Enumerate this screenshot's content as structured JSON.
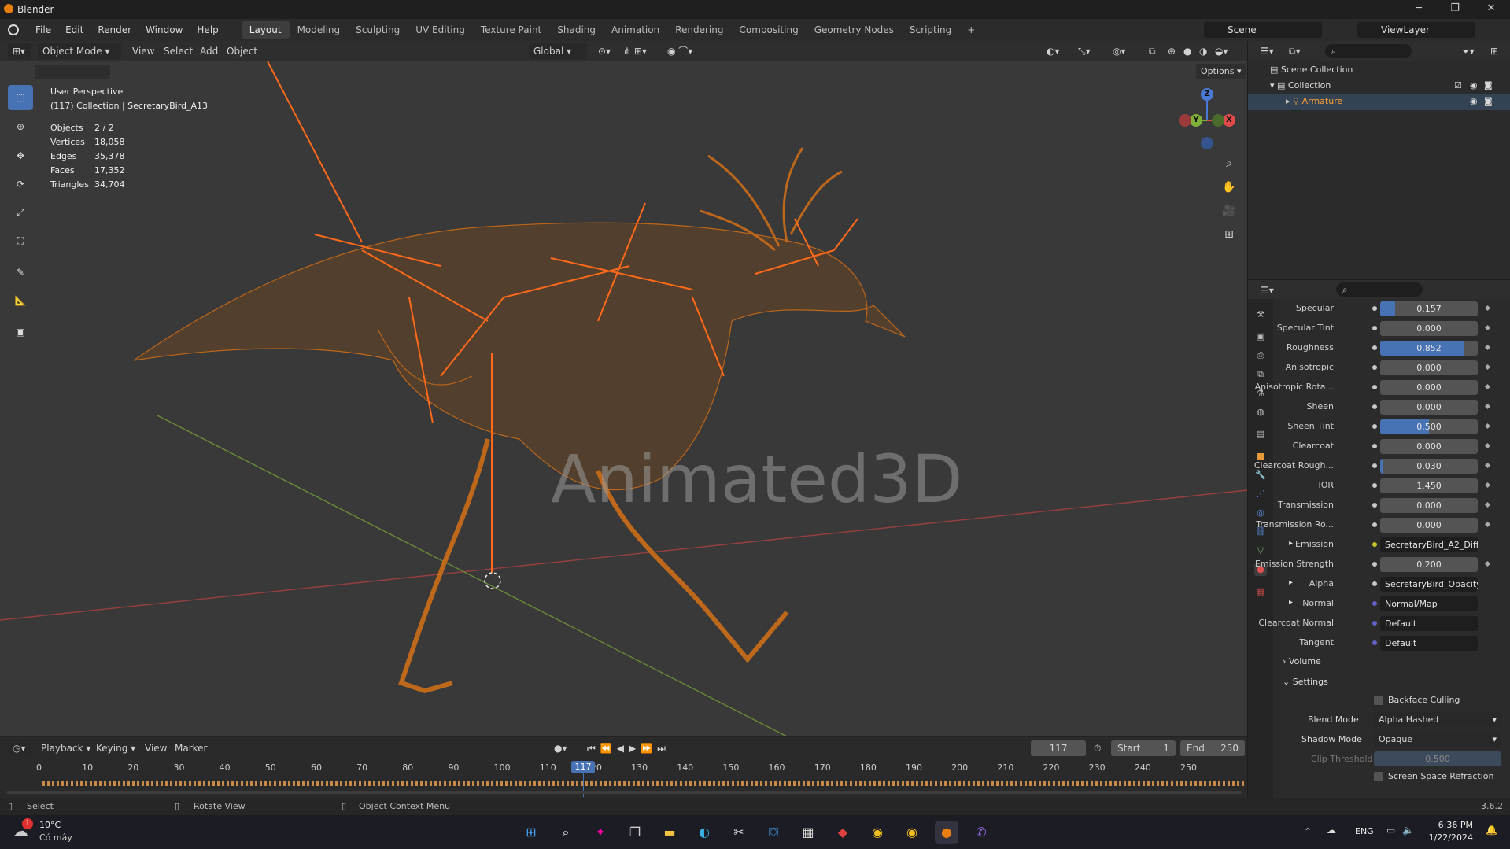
{
  "app": {
    "title": "Blender",
    "version": "3.6.2"
  },
  "window_controls": {
    "minimize": "─",
    "maximize": "❐",
    "close": "✕"
  },
  "menus": [
    "File",
    "Edit",
    "Render",
    "Window",
    "Help"
  ],
  "workspaces": [
    "Layout",
    "Modeling",
    "Sculpting",
    "UV Editing",
    "Texture Paint",
    "Shading",
    "Animation",
    "Rendering",
    "Compositing",
    "Geometry Nodes",
    "Scripting"
  ],
  "workspace_add": "+",
  "scene": {
    "name": "Scene",
    "view_layer": "ViewLayer"
  },
  "viewport_header": {
    "mode": "Object Mode",
    "menus": [
      "View",
      "Select",
      "Add",
      "Object"
    ],
    "orientation": "Global",
    "options": "Options"
  },
  "overlay": {
    "perspective": "User Perspective",
    "collection": "(117) Collection | SecretaryBird_A13",
    "stats": [
      {
        "label": "Objects",
        "value": "2 / 2"
      },
      {
        "label": "Vertices",
        "value": "18,058"
      },
      {
        "label": "Edges",
        "value": "35,378"
      },
      {
        "label": "Faces",
        "value": "17,352"
      },
      {
        "label": "Triangles",
        "value": "34,704"
      }
    ],
    "watermark": "Animated3D"
  },
  "gizmo": {
    "z": "Z",
    "y": "Y",
    "x": "X"
  },
  "outliner": {
    "root": "Scene Collection",
    "collection": "Collection",
    "object": "Armature"
  },
  "properties": {
    "rows": [
      {
        "label": "Specular",
        "value": "0.157",
        "fill": 0.157,
        "type": "slider"
      },
      {
        "label": "Specular Tint",
        "value": "0.000",
        "fill": 0,
        "type": "slider"
      },
      {
        "label": "Roughness",
        "value": "0.852",
        "fill": 0.852,
        "type": "slider"
      },
      {
        "label": "Anisotropic",
        "value": "0.000",
        "fill": 0,
        "type": "slider"
      },
      {
        "label": "Anisotropic Rota...",
        "value": "0.000",
        "fill": 0,
        "type": "slider"
      },
      {
        "label": "Sheen",
        "value": "0.000",
        "fill": 0,
        "type": "slider"
      },
      {
        "label": "Sheen Tint",
        "value": "0.500",
        "fill": 0.5,
        "type": "slider"
      },
      {
        "label": "Clearcoat",
        "value": "0.000",
        "fill": 0,
        "type": "slider"
      },
      {
        "label": "Clearcoat Rough...",
        "value": "0.030",
        "fill": 0.03,
        "type": "slider"
      },
      {
        "label": "IOR",
        "value": "1.450",
        "fill": 0,
        "type": "slider"
      },
      {
        "label": "Transmission",
        "value": "0.000",
        "fill": 0,
        "type": "slider"
      },
      {
        "label": "Transmission Ro...",
        "value": "0.000",
        "fill": 0,
        "type": "slider"
      },
      {
        "label": "Emission",
        "value": "SecretaryBird_A2_Diff...",
        "type": "link",
        "dot": "yel",
        "expand": true
      },
      {
        "label": "Emission Strength",
        "value": "0.200",
        "fill": 0,
        "type": "slider"
      },
      {
        "label": "Alpha",
        "value": "SecretaryBird_Opacity...",
        "type": "link",
        "dot": "gray",
        "expand": true
      },
      {
        "label": "Normal",
        "value": "Normal/Map",
        "type": "link",
        "dot": "blu",
        "expand": true
      },
      {
        "label": "Clearcoat Normal",
        "value": "Default",
        "type": "link",
        "dot": "blu"
      },
      {
        "label": "Tangent",
        "value": "Default",
        "type": "link",
        "dot": "blu"
      }
    ],
    "volume": "Volume",
    "settings": "Settings",
    "backface": "Backface Culling",
    "blend_mode_label": "Blend Mode",
    "blend_mode": "Alpha Hashed",
    "shadow_mode_label": "Shadow Mode",
    "shadow_mode": "Opaque",
    "clip_label": "Clip Threshold",
    "clip_value": "0.500",
    "ssr": "Screen Space Refraction"
  },
  "timeline": {
    "menus": [
      "Playback",
      "Keying",
      "View",
      "Marker"
    ],
    "current_frame": "117",
    "start_label": "Start",
    "start": "1",
    "end_label": "End",
    "end": "250",
    "ticks": [
      "0",
      "10",
      "20",
      "30",
      "40",
      "50",
      "60",
      "70",
      "80",
      "90",
      "100",
      "110",
      "120",
      "130",
      "140",
      "150",
      "160",
      "170",
      "180",
      "190",
      "200",
      "210",
      "220",
      "230",
      "240",
      "250"
    ],
    "frame_marker": "117"
  },
  "status": {
    "select": "Select",
    "rotate": "Rotate View",
    "context": "Object Context Menu"
  },
  "taskbar": {
    "weather_temp": "10°C",
    "weather_desc": "Có mây",
    "weather_badge": "1",
    "lang": "ENG",
    "time": "6:36 PM",
    "date": "1/22/2024"
  }
}
